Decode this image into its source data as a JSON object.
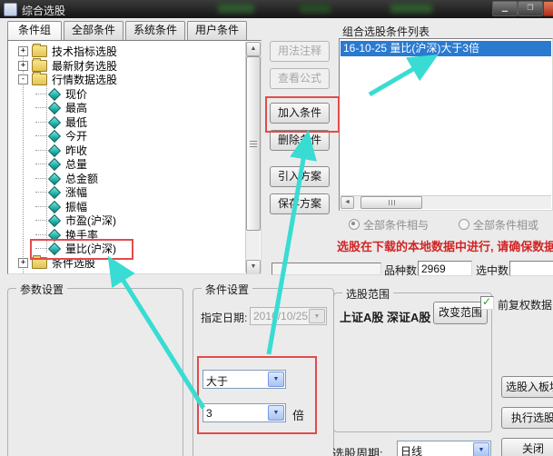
{
  "window": {
    "title": "综合选股"
  },
  "tabs": {
    "group": "条件组",
    "all": "全部条件",
    "system": "系统条件",
    "user": "用户条件"
  },
  "tree": {
    "items": [
      {
        "label": "技术指标选股",
        "type": "folder",
        "expander": "+"
      },
      {
        "label": "最新财务选股",
        "type": "folder",
        "expander": "+"
      },
      {
        "label": "行情数据选股",
        "type": "folder",
        "expander": "-"
      },
      {
        "label": "现价",
        "type": "leaf"
      },
      {
        "label": "最高",
        "type": "leaf"
      },
      {
        "label": "最低",
        "type": "leaf"
      },
      {
        "label": "今开",
        "type": "leaf"
      },
      {
        "label": "昨收",
        "type": "leaf"
      },
      {
        "label": "总量",
        "type": "leaf"
      },
      {
        "label": "总金额",
        "type": "leaf"
      },
      {
        "label": "涨幅",
        "type": "leaf"
      },
      {
        "label": "振幅",
        "type": "leaf"
      },
      {
        "label": "市盈(沪深)",
        "type": "leaf"
      },
      {
        "label": "换手率",
        "type": "leaf"
      },
      {
        "label": "量比(沪深)",
        "type": "leaf",
        "highlighted": true
      },
      {
        "label": "条件选股",
        "type": "folder",
        "expander": "+"
      }
    ]
  },
  "actions": {
    "usage": "用法注释",
    "view_formula": "查看公式",
    "add_condition": "加入条件",
    "delete_condition": "删除条件",
    "import_plan": "引入方案",
    "save_plan": "保存方案"
  },
  "combo_list": {
    "title": "组合选股条件列表",
    "selected_item": "16-10-25 量比(沪深)大于3倍",
    "radio_and": "全部条件相与",
    "radio_or": "全部条件相或"
  },
  "warning_text": "选股在下载的本地数据中进行, 请确保数据完整",
  "status": {
    "species_label": "品种数",
    "species_value": "2969",
    "selected_label": "选中数",
    "selected_value": ""
  },
  "params_group": {
    "title": "参数设置"
  },
  "condition_group": {
    "title": "条件设置",
    "date_label": "指定日期:",
    "date_value": "2016/10/25",
    "operator": "大于",
    "times": "3",
    "unit": "倍"
  },
  "scope_group": {
    "title": "选股范围",
    "markets": "上证A股 深证A股",
    "change_button": "改变范围"
  },
  "side": {
    "restore_label": "前复权数据",
    "to_block": "选股入板块",
    "execute": "执行选股",
    "close": "关闭",
    "period_label": "选股周期:",
    "period_value": "日线"
  },
  "colors": {
    "selection_blue": "#2a7ad0",
    "annotation_red": "#e24b4b",
    "annotation_cyan": "#38dcd2",
    "warning_red": "#d32424",
    "check_green": "#27a227"
  }
}
